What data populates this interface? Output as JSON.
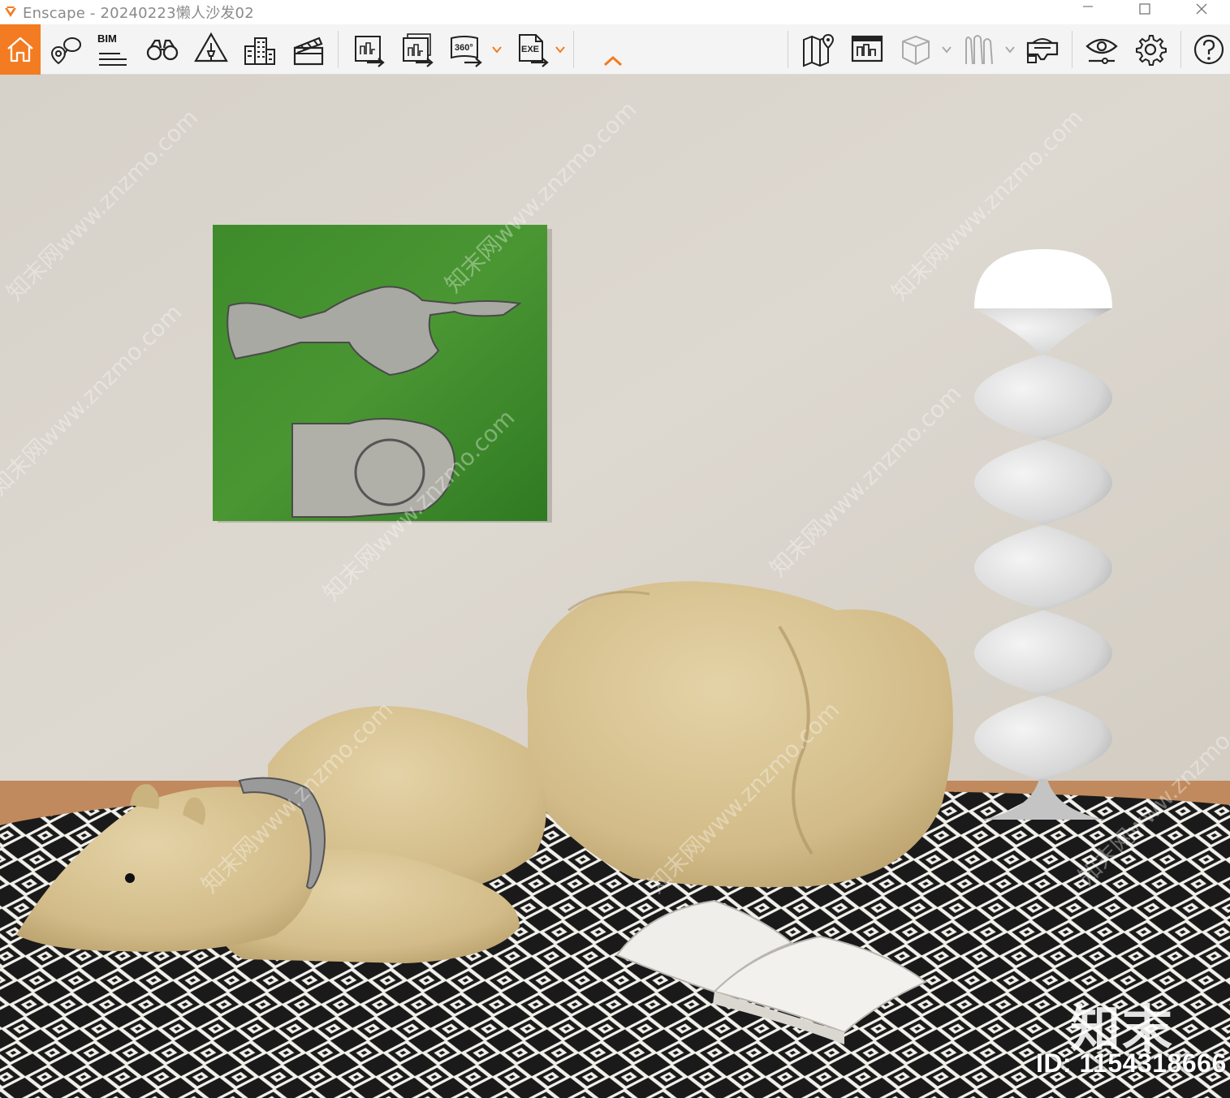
{
  "window": {
    "title": "Enscape - 20240223懒人沙发02",
    "app_logo_color": "#f37b21"
  },
  "toolbar": {
    "accent_color": "#f37b21",
    "bim_label": "BIM",
    "panorama_label": "360°",
    "exe_label": "EXE",
    "buttons": [
      {
        "icon": "home-icon",
        "active": true
      },
      {
        "icon": "views-icon"
      },
      {
        "icon": "bim-icon"
      },
      {
        "icon": "binoculars-icon"
      },
      {
        "icon": "atmosphere-icon"
      },
      {
        "icon": "buildings-icon"
      },
      {
        "icon": "video-clapper-icon"
      },
      {
        "icon": "export-image-icon"
      },
      {
        "icon": "batch-export-icon"
      },
      {
        "icon": "export-360-icon"
      },
      {
        "icon": "export-exe-icon"
      },
      {
        "icon": "collapse-up-icon"
      },
      {
        "icon": "map-icon"
      },
      {
        "icon": "minimap-icon"
      },
      {
        "icon": "cube-icon"
      },
      {
        "icon": "asset-library-icon"
      },
      {
        "icon": "vr-headset-icon"
      },
      {
        "icon": "eye-visual-settings-icon"
      },
      {
        "icon": "settings-gear-icon"
      },
      {
        "icon": "help-icon"
      }
    ]
  },
  "viewport": {
    "watermark_text": "知末网www.znzmo.com",
    "brand_mark": "知末",
    "id_label": "ID: 1154318666",
    "colors": {
      "wall": "#d9d4cc",
      "painting_green": "#3f8a2a",
      "sofa": "#d8c394",
      "floor_wood": "#c08a5e",
      "lamp": "#e8e8e8"
    }
  }
}
